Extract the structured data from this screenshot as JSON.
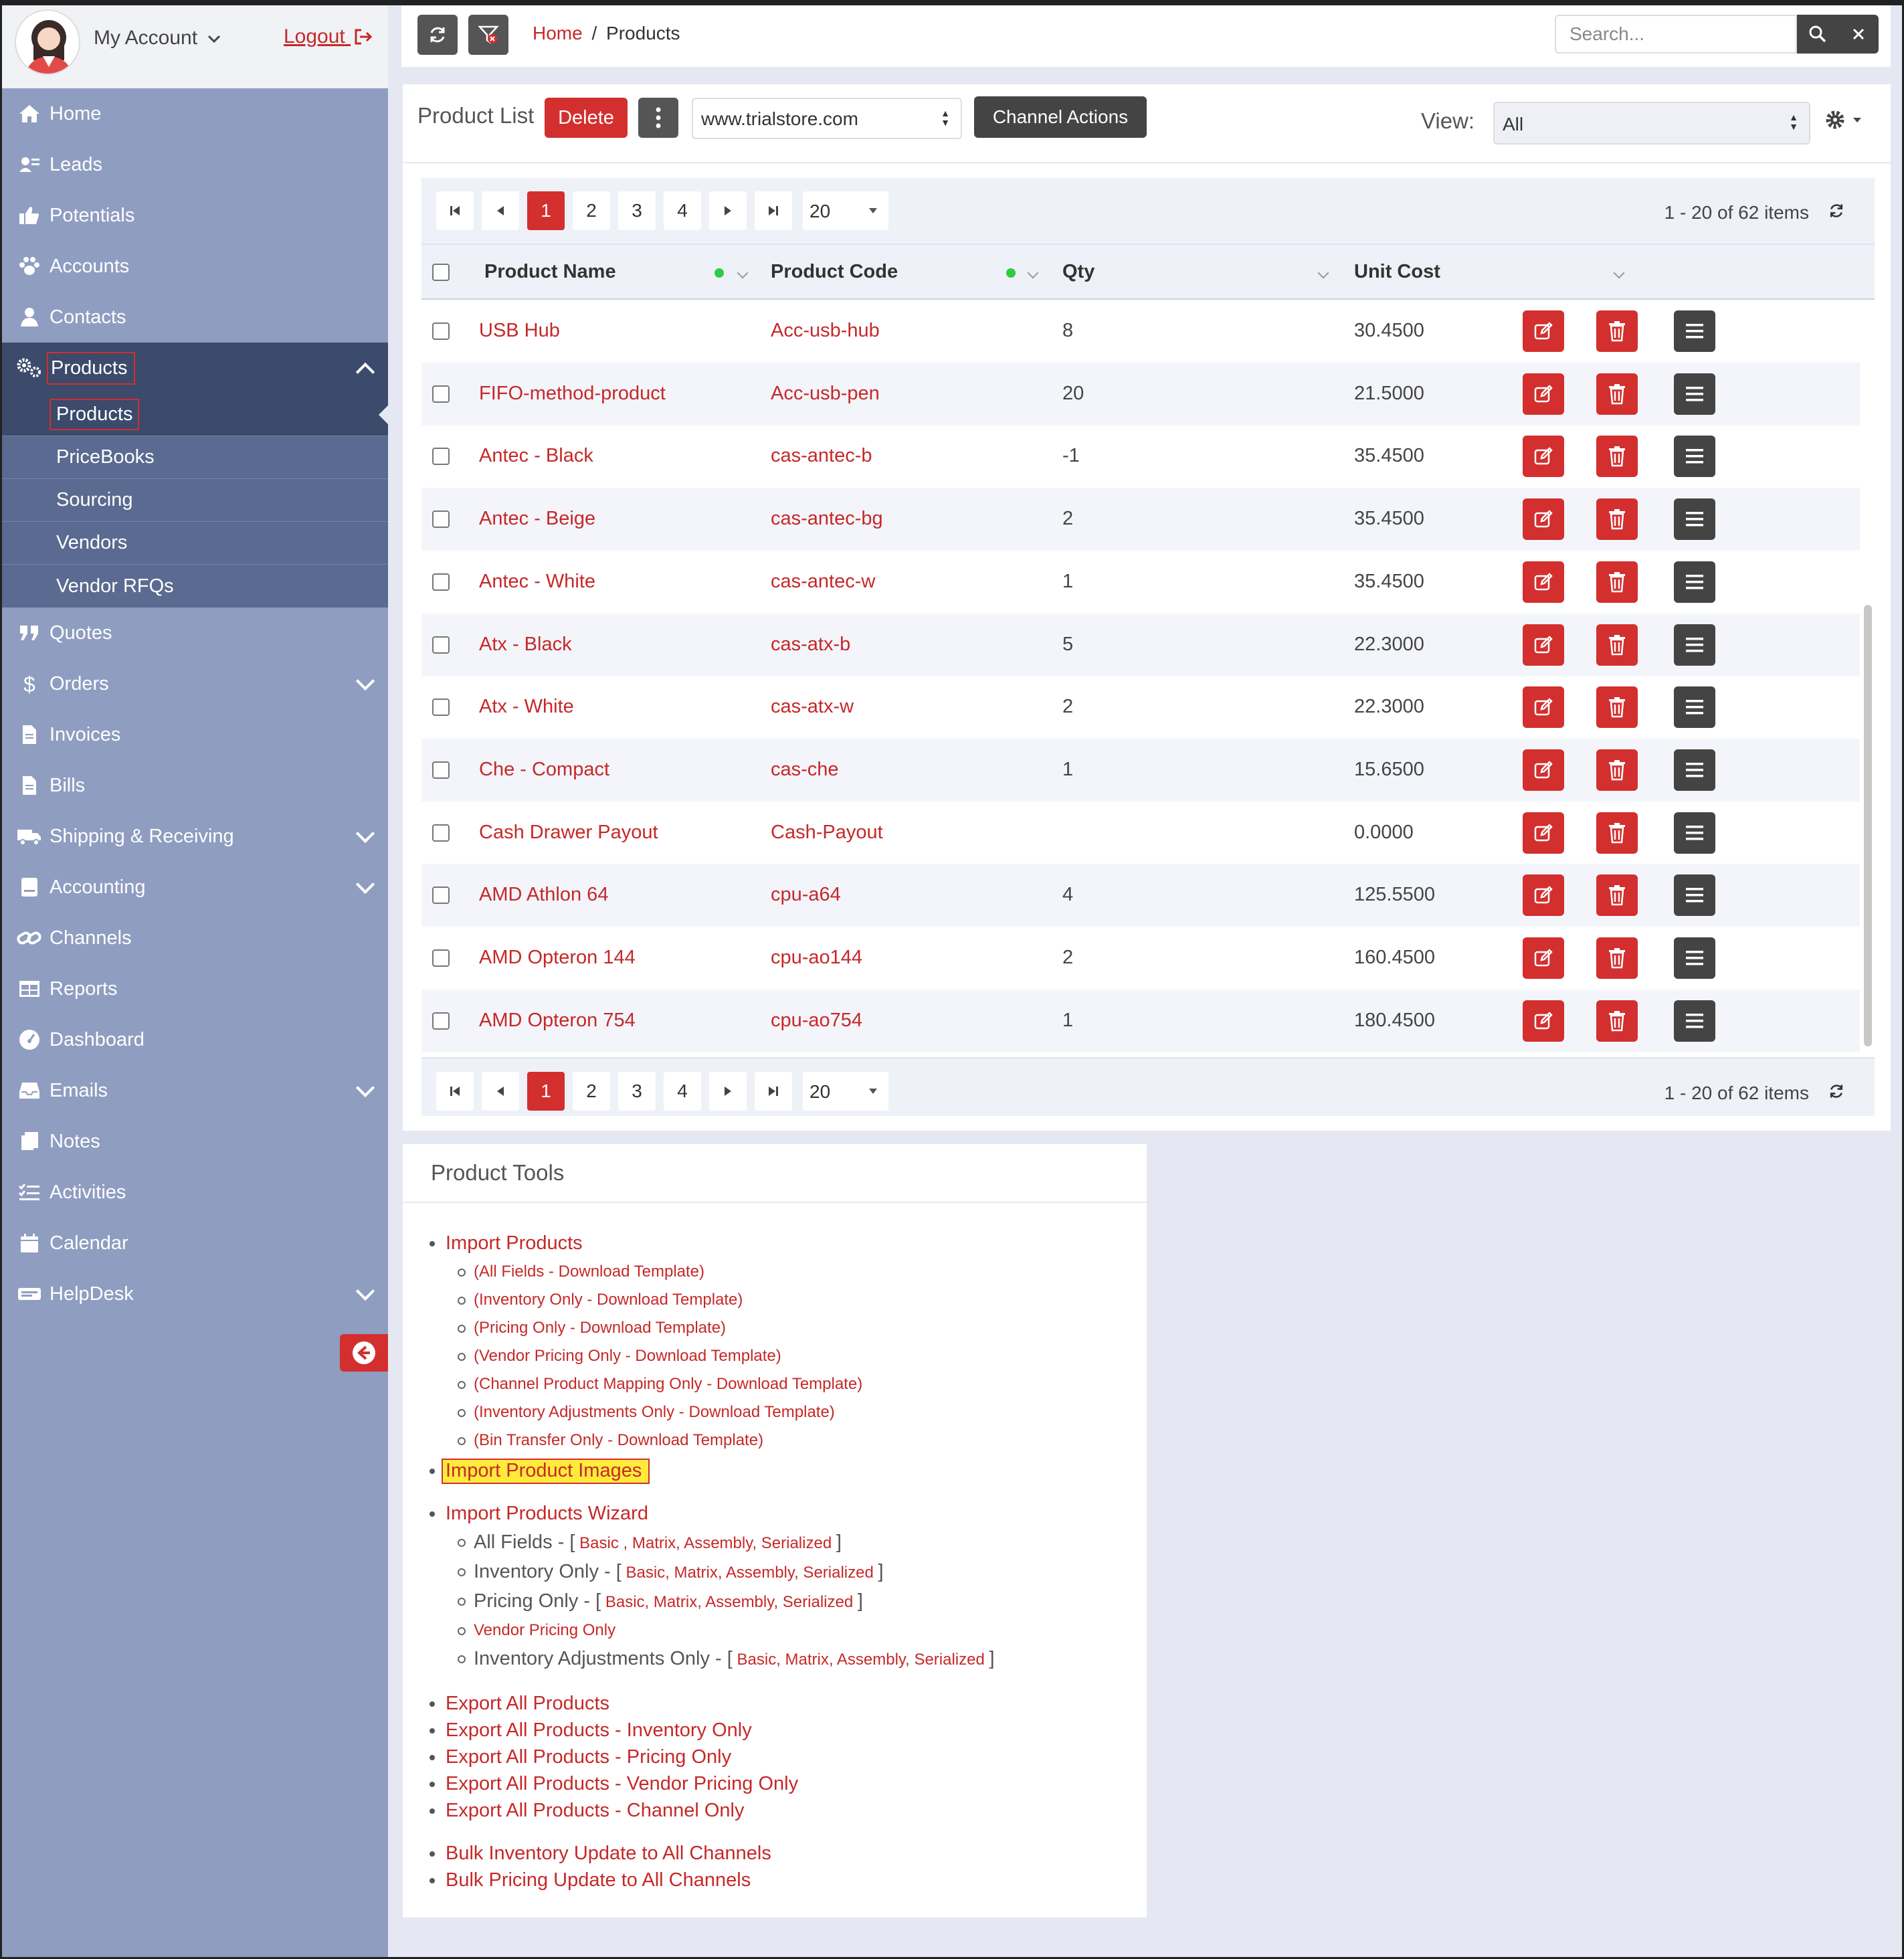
{
  "sidebar": {
    "account_label": "My Account",
    "logout_label": "Logout",
    "items": [
      {
        "label": "Home",
        "icon": "home-icon"
      },
      {
        "label": "Leads",
        "icon": "leads-icon"
      },
      {
        "label": "Potentials",
        "icon": "thumbs-up-icon"
      },
      {
        "label": "Accounts",
        "icon": "paw-icon"
      },
      {
        "label": "Contacts",
        "icon": "user-icon"
      },
      {
        "label": "Products",
        "icon": "gears-icon"
      },
      {
        "label": "Quotes",
        "icon": "quote-icon"
      },
      {
        "label": "Orders",
        "icon": "dollar-icon"
      },
      {
        "label": "Invoices",
        "icon": "document-icon"
      },
      {
        "label": "Bills",
        "icon": "document-icon"
      },
      {
        "label": "Shipping & Receiving",
        "icon": "truck-icon"
      },
      {
        "label": "Accounting",
        "icon": "ledger-icon"
      },
      {
        "label": "Channels",
        "icon": "link-icon"
      },
      {
        "label": "Reports",
        "icon": "table-icon"
      },
      {
        "label": "Dashboard",
        "icon": "gauge-icon"
      },
      {
        "label": "Emails",
        "icon": "inbox-icon"
      },
      {
        "label": "Notes",
        "icon": "notes-icon"
      },
      {
        "label": "Activities",
        "icon": "tasks-icon"
      },
      {
        "label": "Calendar",
        "icon": "calendar-icon"
      },
      {
        "label": "HelpDesk",
        "icon": "helpdesk-icon"
      }
    ],
    "submenu": [
      "Products",
      "PriceBooks",
      "Sourcing",
      "Vendors",
      "Vendor RFQs"
    ]
  },
  "topbar": {
    "breadcrumb_home": "Home",
    "breadcrumb_sep": "/",
    "breadcrumb_current": "Products",
    "search_placeholder": "Search..."
  },
  "product_list": {
    "title": "Product List",
    "delete_label": "Delete",
    "channel_value": "www.trialstore.com",
    "channel_actions_label": "Channel Actions",
    "view_label": "View:",
    "view_value": "All",
    "pages": [
      "1",
      "2",
      "3",
      "4"
    ],
    "page_size": "20",
    "items_info": "1 - 20 of 62 items",
    "columns": [
      "Product Name",
      "Product Code",
      "Qty",
      "Unit Cost"
    ],
    "rows": [
      {
        "name": "USB Hub",
        "code": "Acc-usb-hub",
        "qty": "8",
        "cost": "30.4500"
      },
      {
        "name": "FIFO-method-product",
        "code": "Acc-usb-pen",
        "qty": "20",
        "cost": "21.5000"
      },
      {
        "name": "Antec - Black",
        "code": "cas-antec-b",
        "qty": "-1",
        "cost": "35.4500"
      },
      {
        "name": "Antec - Beige",
        "code": "cas-antec-bg",
        "qty": "2",
        "cost": "35.4500"
      },
      {
        "name": "Antec - White",
        "code": "cas-antec-w",
        "qty": "1",
        "cost": "35.4500"
      },
      {
        "name": "Atx - Black",
        "code": "cas-atx-b",
        "qty": "5",
        "cost": "22.3000"
      },
      {
        "name": "Atx - White",
        "code": "cas-atx-w",
        "qty": "2",
        "cost": "22.3000"
      },
      {
        "name": "Che - Compact",
        "code": "cas-che",
        "qty": "1",
        "cost": "15.6500"
      },
      {
        "name": "Cash Drawer Payout",
        "code": "Cash-Payout",
        "qty": "",
        "cost": "0.0000"
      },
      {
        "name": "AMD Athlon 64",
        "code": "cpu-a64",
        "qty": "4",
        "cost": "125.5500"
      },
      {
        "name": "AMD Opteron 144",
        "code": "cpu-ao144",
        "qty": "2",
        "cost": "160.4500"
      },
      {
        "name": "AMD Opteron 754",
        "code": "cpu-ao754",
        "qty": "1",
        "cost": "180.4500"
      }
    ]
  },
  "tools": {
    "title": "Product Tools",
    "import_products": "Import Products",
    "import_templates": [
      "(All Fields - Download Template)",
      "(Inventory Only - Download Template)",
      "(Pricing Only - Download Template)",
      "(Vendor Pricing Only - Download Template)",
      "(Channel Product Mapping Only - Download Template)",
      "(Inventory Adjustments Only - Download Template)",
      "(Bin Transfer Only - Download Template)"
    ],
    "import_images": "Import Product Images",
    "wizard": "Import Products Wizard",
    "wizard_items": [
      {
        "label": "All Fields - [",
        "links": [
          "Basic",
          ", Matrix",
          ", Assembly",
          ", Serialized"
        ]
      },
      {
        "label": "Inventory Only - [",
        "links": [
          "Basic",
          ", Matrix",
          ", Assembly",
          ", Serialized"
        ]
      },
      {
        "label": "Pricing Only - [",
        "links": [
          "Basic",
          ", Matrix",
          ", Assembly",
          ", Serialized"
        ]
      },
      {
        "label": "Inventory Adjustments Only - [",
        "links": [
          "Basic",
          ", Matrix",
          ", Assembly",
          ", Serialized"
        ]
      }
    ],
    "wizard_all_fields_links": "Basic , Matrix, Assembly, Serialized",
    "wizard_links": "Basic, Matrix, Assembly, Serialized",
    "close_bracket": "]",
    "vendor_pricing_only": "Vendor Pricing Only",
    "exports": [
      "Export All Products",
      "Export All Products - Inventory Only",
      "Export All Products - Pricing Only",
      "Export All Products - Vendor Pricing Only",
      "Export All Products - Channel Only"
    ],
    "bulk": [
      "Bulk Inventory Update to All Channels",
      "Bulk Pricing Update to All Channels"
    ]
  },
  "colors": {
    "accent": "#d32f2f",
    "sidebar": "#8f9dc0",
    "sidebar_active": "#3c4a6b",
    "highlight": "#ffeb3b"
  }
}
